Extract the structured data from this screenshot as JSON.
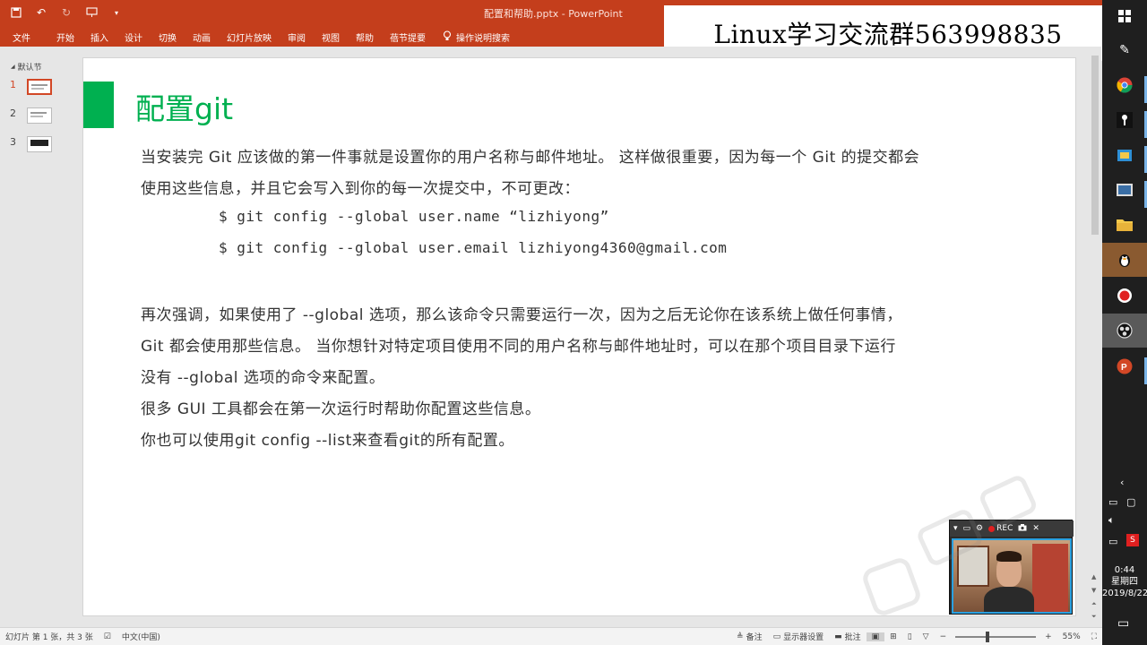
{
  "window": {
    "title": "配置和帮助.pptx - PowerPoint",
    "accent": "#c43e1c"
  },
  "ribbon": {
    "tabs": [
      "文件",
      "开始",
      "插入",
      "设计",
      "切换",
      "动画",
      "幻灯片放映",
      "审阅",
      "视图",
      "帮助",
      "蓓节提要"
    ],
    "tell_me": "操作说明搜索"
  },
  "banner": {
    "text": "Linux学习交流群563998835"
  },
  "sidebar": {
    "section": "默认节",
    "slides": [
      "1",
      "2",
      "3"
    ]
  },
  "slide": {
    "title": "配置git",
    "title_color": "#00b050",
    "lines": [
      "当安装完 Git 应该做的第一件事就是设置你的用户名称与邮件地址。 这样做很重要，因为每一个 Git 的提交都会",
      "使用这些信息，并且它会写入到你的每一次提交中，不可更改：",
      "$ git config --global user.name “lizhiyong”",
      "$ git config --global user.email lizhiyong4360@gmail.com",
      "再次强调，如果使用了 --global 选项，那么该命令只需要运行一次，因为之后无论你在该系统上做任何事情，",
      "Git 都会使用那些信息。 当你想针对特定项目使用不同的用户名称与邮件地址时，可以在那个项目目录下运行",
      "没有 --global 选项的命令来配置。",
      "很多 GUI 工具都会在第一次运行时帮助你配置这些信息。",
      "你也可以使用git config --list来查看git的所有配置。"
    ]
  },
  "status": {
    "slide_info": "幻灯片 第 1 张，共 3 张",
    "language": "中文(中国)",
    "notes": "备注",
    "display_settings": "显示器设置",
    "comments": "批注",
    "zoom": "55%"
  },
  "webcam": {
    "rec_label": "REC"
  },
  "taskbar": {
    "time": "0:44",
    "weekday": "星期四",
    "date": "2019/8/22"
  }
}
